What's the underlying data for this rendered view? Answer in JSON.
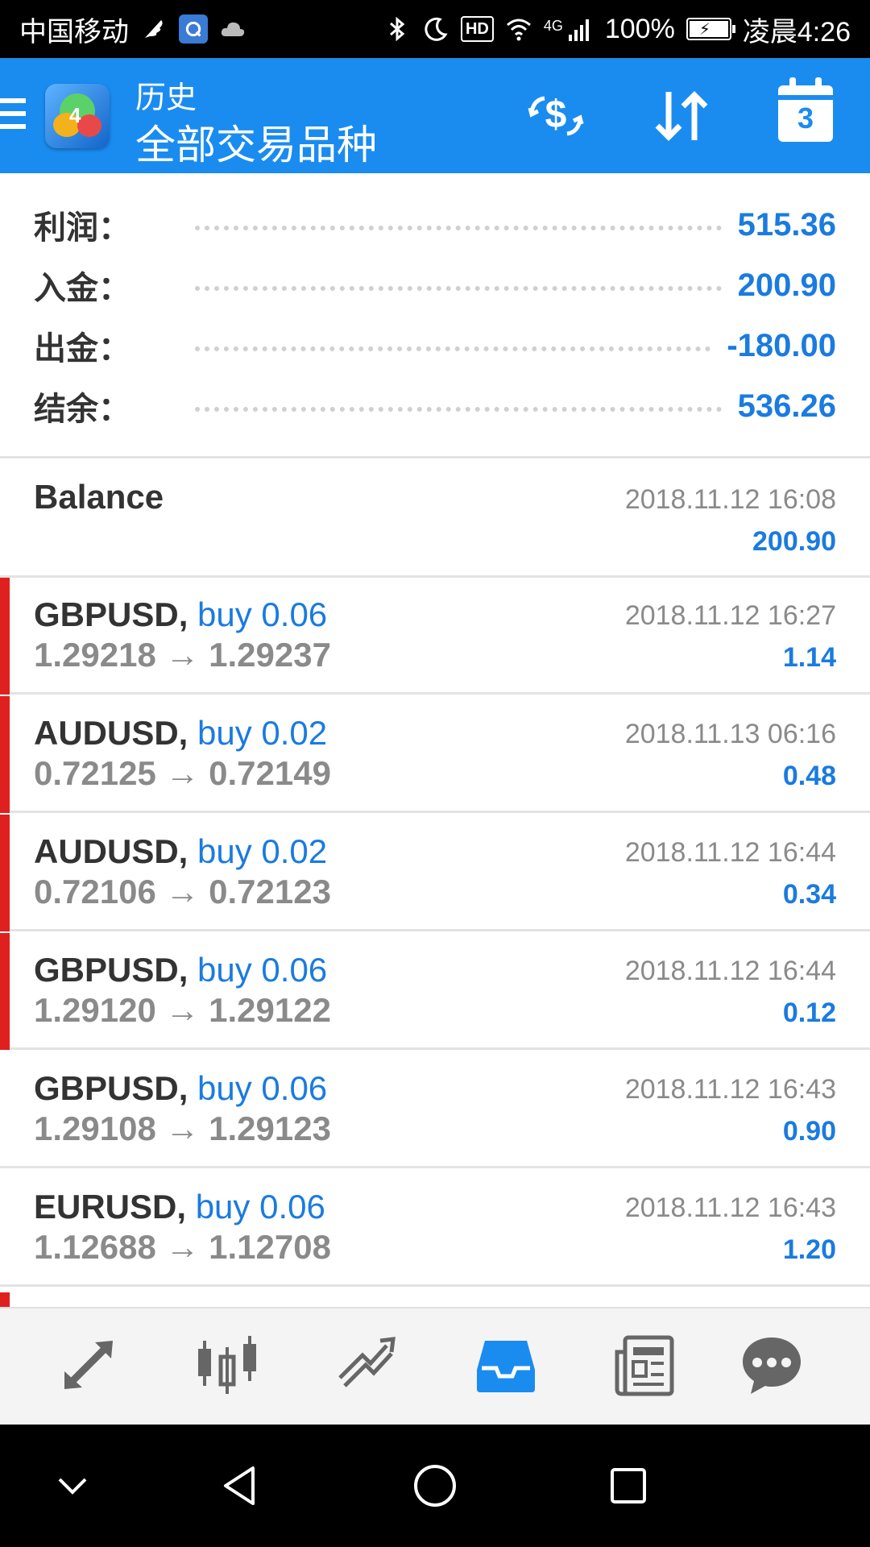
{
  "statusbar": {
    "carrier": "中国移动",
    "network": "4G",
    "battery": "100%",
    "time": "凌晨4:26",
    "hd": "HD"
  },
  "header": {
    "subtitle": "历史",
    "title": "全部交易品种",
    "calendar_day": "3",
    "logo_number": "4"
  },
  "summary": [
    {
      "label": "利润：",
      "value": "515.36"
    },
    {
      "label": "入金：",
      "value": "200.90"
    },
    {
      "label": "出金：",
      "value": "-180.00"
    },
    {
      "label": "结余：",
      "value": "536.26"
    }
  ],
  "balance": {
    "label": "Balance",
    "datetime": "2018.11.12 16:08",
    "amount": "200.90"
  },
  "deals": [
    {
      "symbol": "GBPUSD,",
      "action": "buy 0.06",
      "prices": "1.29218 → 1.29237",
      "datetime": "2018.11.12 16:27",
      "profit": "1.14"
    },
    {
      "symbol": "AUDUSD,",
      "action": "buy 0.02",
      "prices": "0.72125 → 0.72149",
      "datetime": "2018.11.13 06:16",
      "profit": "0.48"
    },
    {
      "symbol": "AUDUSD,",
      "action": "buy 0.02",
      "prices": "0.72106 → 0.72123",
      "datetime": "2018.11.12 16:44",
      "profit": "0.34"
    },
    {
      "symbol": "GBPUSD,",
      "action": "buy 0.06",
      "prices": "1.29120 → 1.29122",
      "datetime": "2018.11.12 16:44",
      "profit": "0.12"
    },
    {
      "symbol": "GBPUSD,",
      "action": "buy 0.06",
      "prices": "1.29108 → 1.29123",
      "datetime": "2018.11.12 16:43",
      "profit": "0.90"
    },
    {
      "symbol": "EURUSD,",
      "action": "buy 0.06",
      "prices": "1.12688 → 1.12708",
      "datetime": "2018.11.12 16:43",
      "profit": "1.20"
    }
  ],
  "colors": {
    "accent": "#1a8cf0",
    "value_blue": "#1a7be0",
    "buy_marker": "#e0201e"
  },
  "bottom_nav_icons": [
    "quotes-icon",
    "chart-icon",
    "trade-icon",
    "history-icon",
    "news-icon",
    "chat-icon"
  ]
}
